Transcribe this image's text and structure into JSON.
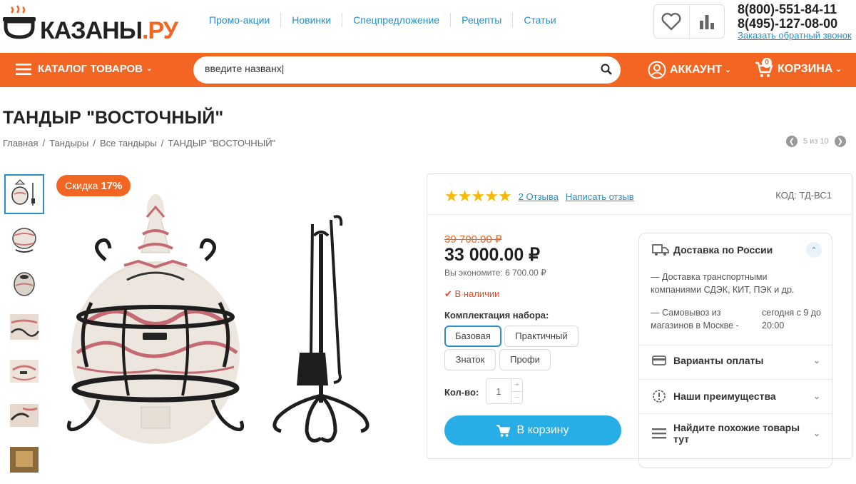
{
  "header": {
    "logo_main": "КАЗАНЫ",
    "logo_suffix": ".РУ",
    "nav": [
      "Промо-акции",
      "Новинки",
      "Спецпредложение",
      "Рецепты",
      "Статьи"
    ],
    "phone1": "8(800)-551-84-11",
    "phone2": "8(495)-127-08-00",
    "callback": "Заказать обратный звонок"
  },
  "bar": {
    "catalog": "КАТАЛОГ ТОВАРОВ",
    "search_value": "введите названх|",
    "account": "АККАУНТ",
    "cart": "КОРЗИНА",
    "cart_count": "0"
  },
  "product": {
    "title": "ТАНДЫР \"ВОСТОЧНЫЙ\"",
    "breadcrumbs": [
      "Главная",
      "Тандыры",
      "Все тандыры",
      "ТАНДЫР \"ВОСТОЧНЫЙ\""
    ],
    "pager": "5 из 10",
    "discount_label": "Скидка",
    "discount_value": "17%",
    "reviews": "2 Отзыва",
    "write_review": "Написать отзыв",
    "code": "КОД:  ТД-ВС1",
    "old_price": "39 700.00 ₽",
    "price": "33 000.00 ₽",
    "savings": "Вы экономите: 6 700.00 ₽",
    "stock": "В наличии",
    "kit_label": "Комплектация набора:",
    "options": [
      "Базовая",
      "Практичный",
      "Знаток",
      "Профи"
    ],
    "qty_label": "Кол-во:",
    "qty": "1",
    "add_to_cart": "В корзину",
    "rating": 5
  },
  "sidebar": {
    "delivery_title": "Доставка по России",
    "delivery_text": "— Доставка транспортными компаниями СДЭК, КИТ, ПЭК и др.",
    "pickup_text": "— Самовывоз из магазинов в Москве -",
    "pickup_time": "сегодня с 9 до 20:00",
    "payment": "Варианты оплаты",
    "advantages": "Наши преимущества",
    "similar": "Найдите похожие товары тут"
  },
  "colors": {
    "accent": "#f26522",
    "link": "#2a8ec8",
    "cart_button": "#27aee6",
    "star": "#f6b800"
  }
}
